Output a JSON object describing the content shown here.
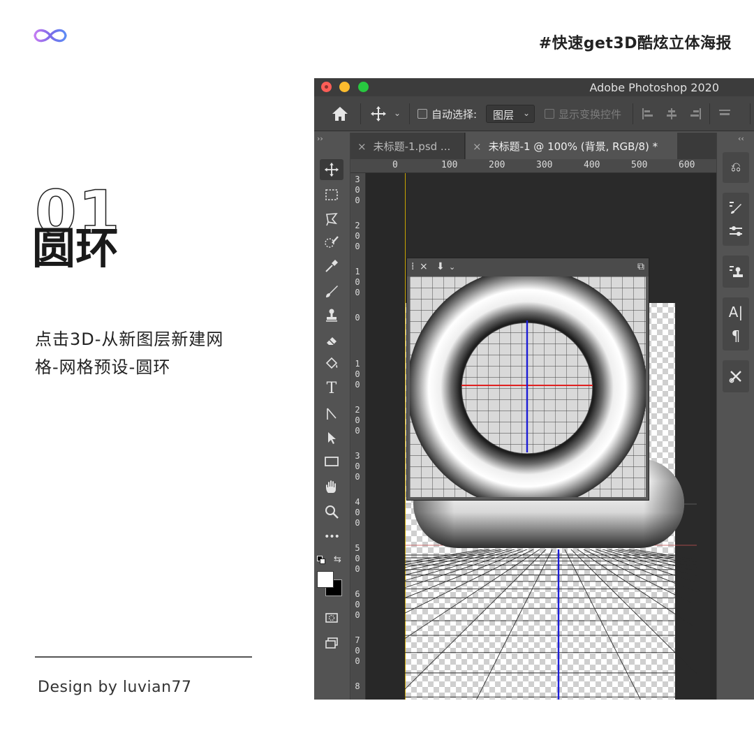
{
  "poster": {
    "hashtag": "#快速get3D酷炫立体海报",
    "step_number": "01",
    "step_title": "圆环",
    "description_line1": "点击3D-从新图层新建网",
    "description_line2": "格-网格预设-圆环",
    "credit": "Design by luvian77",
    "logo_icon": "infinity-icon",
    "logo_gradient": [
      "#c47cf2",
      "#7c6ae8",
      "#5d8cf5"
    ]
  },
  "window": {
    "title": "Adobe Photoshop 2020",
    "colors": {
      "close": "#fc5e57",
      "minimize": "#fdbc2e",
      "zoom": "#28c840"
    }
  },
  "options_bar": {
    "auto_select_label": "自动选择:",
    "auto_select_checked": false,
    "target_select_value": "图层",
    "transform_controls_label": "显示变换控件",
    "transform_controls_checked": false
  },
  "tabs": [
    {
      "label": "未标题-1.psd ...",
      "active": false
    },
    {
      "label": "未标题-1 @ 100% (背景, RGB/8) *",
      "active": true
    }
  ],
  "ruler": {
    "top_labels": [
      "0",
      "100",
      "200",
      "300",
      "400",
      "500",
      "600"
    ],
    "left_labels": [
      [
        "3",
        "0",
        "0"
      ],
      [
        "2",
        "0",
        "0"
      ],
      [
        "1",
        "0",
        "0"
      ],
      [
        "0"
      ],
      [
        "1",
        "0",
        "0"
      ],
      [
        "2",
        "0",
        "0"
      ],
      [
        "3",
        "0",
        "0"
      ],
      [
        "4",
        "0",
        "0"
      ],
      [
        "5",
        "0",
        "0"
      ],
      [
        "6",
        "0",
        "0"
      ],
      [
        "7",
        "0",
        "0"
      ],
      [
        "8"
      ]
    ]
  },
  "tools": [
    "move-tool",
    "marquee-tool",
    "lasso-tool",
    "quick-selection-tool",
    "eyedropper-tool",
    "brush-tool",
    "clone-stamp-tool",
    "eraser-tool",
    "paint-bucket-tool",
    "type-tool",
    "path-selection-tool",
    "direct-selection-tool",
    "rectangle-tool",
    "hand-tool",
    "zoom-tool",
    "more-tools"
  ],
  "tool_glyphs": {
    "type": "T",
    "more": "•••"
  },
  "colors": {
    "foreground": "#ffffff",
    "background": "#000000",
    "axis_x": "#e02020",
    "axis_y": "#1c1cd6"
  },
  "right_panels": {
    "groups": [
      [
        "history-icon"
      ],
      [
        "brush-settings-icon",
        "adjust-icon"
      ],
      [
        "properties-icon"
      ],
      [
        "character-icon",
        "paragraph-icon"
      ],
      [
        "tools-icon"
      ]
    ],
    "character_glyph": "A|",
    "paragraph_glyph": "¶"
  }
}
